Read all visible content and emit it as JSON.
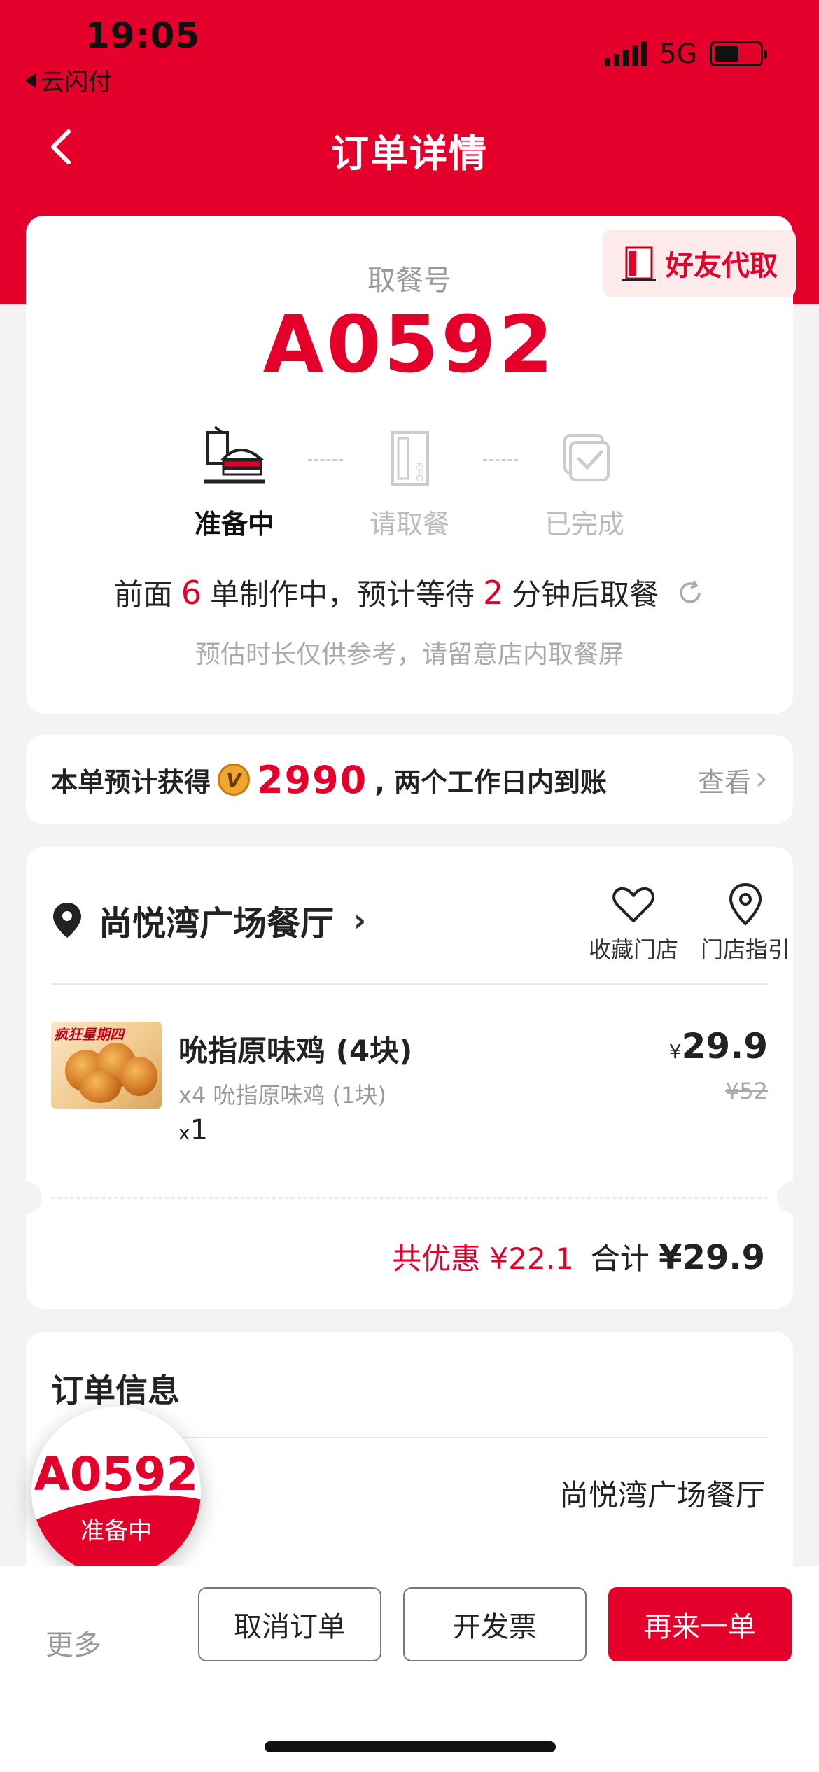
{
  "status_bar": {
    "time": "19:05",
    "back_app": "云闪付",
    "network": "5G",
    "battery_level": 0.55
  },
  "nav": {
    "title": "订单详情"
  },
  "pickup": {
    "friend_pick_label": "好友代取",
    "label": "取餐号",
    "number": "A0592",
    "steps": [
      {
        "label": "准备中",
        "active": true
      },
      {
        "label": "请取餐",
        "active": false
      },
      {
        "label": "已完成",
        "active": false
      }
    ],
    "wait": {
      "prefix": "前面",
      "orders_ahead": "6",
      "middle": "单制作中，预计等待",
      "minutes": "2",
      "suffix": "分钟后取餐"
    },
    "note": "预估时长仅供参考，请留意店内取餐屏"
  },
  "points": {
    "prefix": "本单预计获得",
    "coin_icon_text": "V",
    "amount": "2990",
    "suffix": ", 两个工作日内到账",
    "view_label": "查看"
  },
  "order": {
    "store_name": "尚悦湾广场餐厅",
    "actions": [
      {
        "label": "收藏门店",
        "icon": "heart-icon"
      },
      {
        "label": "门店指引",
        "icon": "location-pin-icon"
      }
    ],
    "item": {
      "image_tag": "疯狂星期四",
      "name": "吮指原味鸡 (4块)",
      "sub": "x4 吮指原味鸡 (1块)",
      "qty_x": "x",
      "qty": "1",
      "currency": "¥",
      "price": "29.9",
      "original_price": "¥52"
    },
    "discount": "共优惠 ¥22.1",
    "total_label": "合计",
    "total": "¥29.9"
  },
  "info": {
    "title": "订单信息",
    "store": "尚悦湾广场餐厅"
  },
  "bubble": {
    "number": "A0592",
    "status": "准备中"
  },
  "bottom_bar": {
    "more": "更多",
    "cancel": "取消订单",
    "invoice": "开发票",
    "reorder": "再来一单"
  },
  "colors": {
    "brand_red": "#e4002b",
    "background": "#f3f3f3"
  }
}
